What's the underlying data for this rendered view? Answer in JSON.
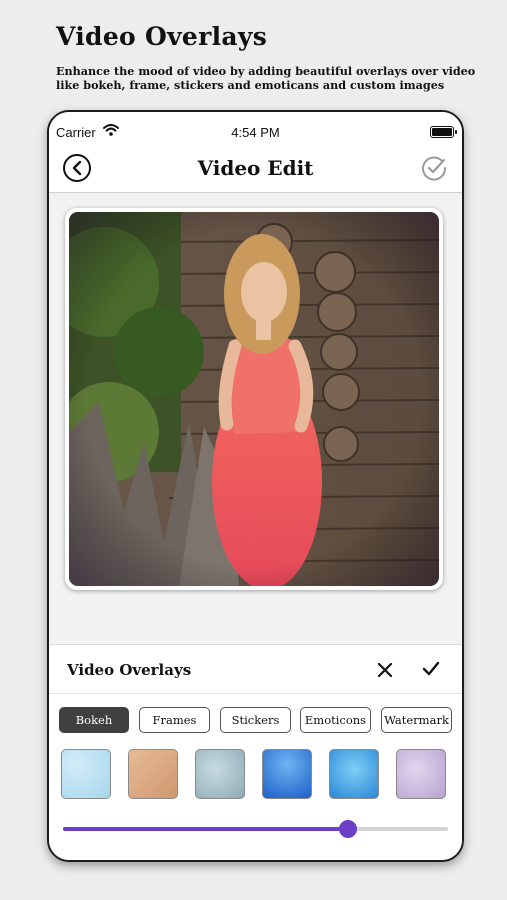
{
  "headline": "Video Overlays",
  "subline": "Enhance the mood of video by adding beautiful overlays over video like bokeh, frame, stickers and emoticans and custom images",
  "status": {
    "carrier": "Carrier",
    "time": "4:54 PM"
  },
  "nav": {
    "title": "Video Edit",
    "back_icon": "back-circle-icon",
    "done_icon": "check-circle-icon"
  },
  "preview": {
    "image": "woman-in-coral-dress-photo"
  },
  "panel": {
    "title": "Video Overlays",
    "close_icon": "close-icon",
    "confirm_icon": "checkmark-icon",
    "tabs": [
      {
        "label": "Bokeh",
        "active": true
      },
      {
        "label": "Frames",
        "active": false
      },
      {
        "label": "Stickers",
        "active": false
      },
      {
        "label": "Emoticons",
        "active": false
      },
      {
        "label": "Watermark",
        "active": false
      }
    ],
    "overlays": [
      {
        "name": "light-blue-texture",
        "color": "#a6d6ee"
      },
      {
        "name": "beige-paper-texture",
        "color": "#d8a77e"
      },
      {
        "name": "grey-blue-bokeh",
        "color": "#9db8c2"
      },
      {
        "name": "blue-sparkle-bokeh",
        "color": "#2a7fd8"
      },
      {
        "name": "cyan-sparkle-bokeh",
        "color": "#3aa6e6"
      },
      {
        "name": "lavender-texture",
        "color": "#c6b4d9"
      }
    ],
    "intensity": 0.74,
    "accent": "#6c3fc7"
  }
}
